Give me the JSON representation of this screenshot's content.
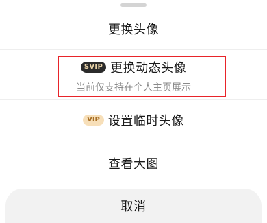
{
  "menu": {
    "change_avatar": "更换头像",
    "dynamic": {
      "badge": "SVIP",
      "label": "更换动态头像",
      "sublabel": "当前仅支持在个人主页展示"
    },
    "temp": {
      "badge": "VIP",
      "label": "设置临时头像"
    },
    "view_large": "查看大图",
    "cancel": "取消"
  },
  "colors": {
    "highlight_border": "#e8242a",
    "svip_badge_bg": "#2b2b2b",
    "svip_badge_text": "#e9d3a8",
    "vip_badge_bg": "#f7dfb9",
    "vip_badge_text": "#a86f24",
    "cancel_bg": "#f2f2f2"
  }
}
